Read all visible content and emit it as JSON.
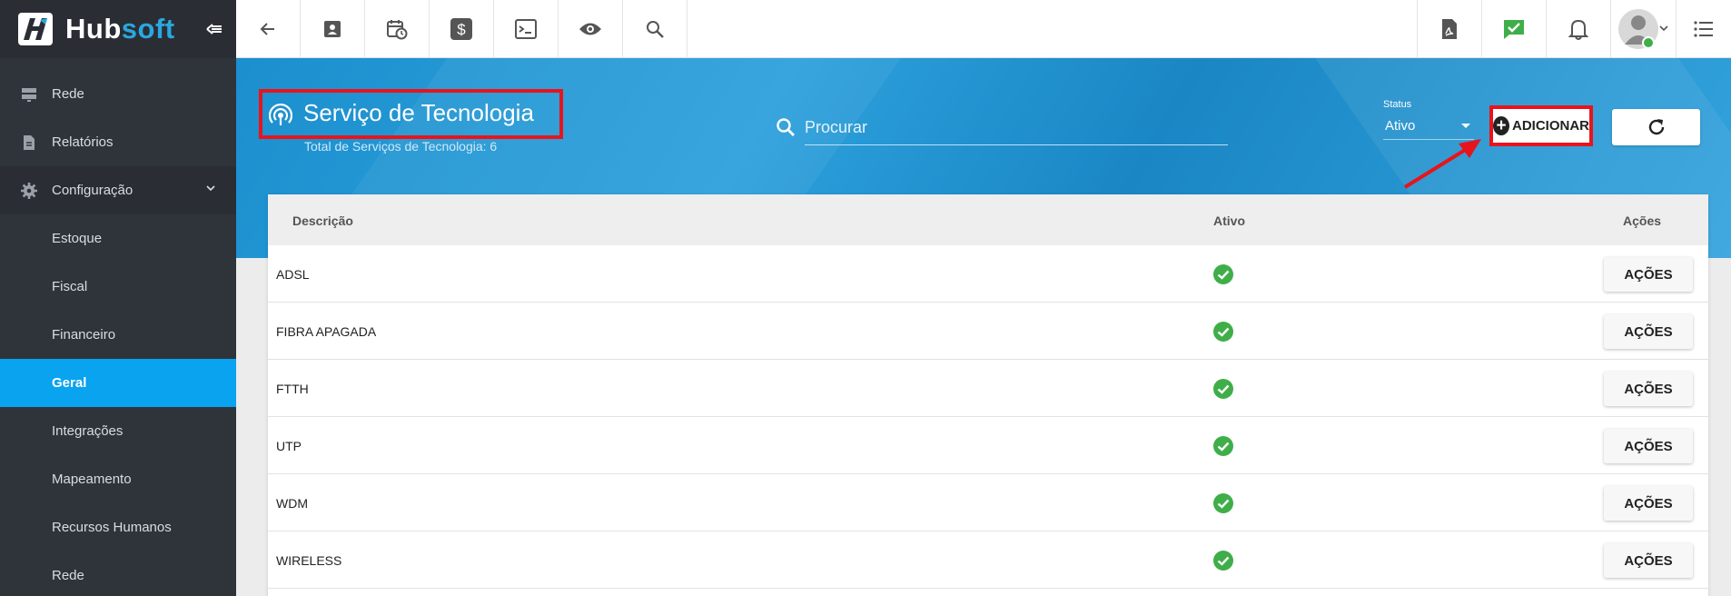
{
  "brand": {
    "part1": "Hub",
    "part2": "soft"
  },
  "sidebar": {
    "items": [
      {
        "label": "Rede",
        "icon": "server-icon"
      },
      {
        "label": "Relatórios",
        "icon": "document-icon"
      },
      {
        "label": "Configuração",
        "icon": "gear-icon"
      }
    ],
    "sub_items": [
      {
        "label": "Estoque"
      },
      {
        "label": "Fiscal"
      },
      {
        "label": "Financeiro"
      },
      {
        "label": "Geral",
        "active": true
      },
      {
        "label": "Integrações"
      },
      {
        "label": "Mapeamento"
      },
      {
        "label": "Recursos Humanos"
      },
      {
        "label": "Rede"
      }
    ]
  },
  "topbar": {
    "left_icons": [
      "back-arrow-icon",
      "contact-card-icon",
      "calendar-clock-icon",
      "dollar-icon",
      "terminal-icon",
      "eye-icon",
      "search-icon"
    ],
    "right_icons": [
      "pdf-icon",
      "chat-check-icon",
      "bell-icon",
      "avatar",
      "menu-list-icon"
    ]
  },
  "header": {
    "title": "Serviço de Tecnologia",
    "subtitle": "Total de Serviços de Tecnologia: 6",
    "search_placeholder": "Procurar",
    "status_label": "Status",
    "status_value": "Ativo",
    "add_label": "ADICIONAR"
  },
  "table": {
    "columns": {
      "descricao": "Descrição",
      "ativo": "Ativo",
      "acoes": "Ações"
    },
    "rows": [
      {
        "descricao": "ADSL",
        "acoes": "AÇÕES"
      },
      {
        "descricao": "FIBRA APAGADA",
        "acoes": "AÇÕES"
      },
      {
        "descricao": "FTTH",
        "acoes": "AÇÕES"
      },
      {
        "descricao": "UTP",
        "acoes": "AÇÕES"
      },
      {
        "descricao": "WDM",
        "acoes": "AÇÕES"
      },
      {
        "descricao": "WIRELESS",
        "acoes": "AÇÕES"
      }
    ]
  },
  "colors": {
    "accent": "#0aa3ef",
    "highlight": "#e8141c",
    "check": "#3fae49"
  }
}
